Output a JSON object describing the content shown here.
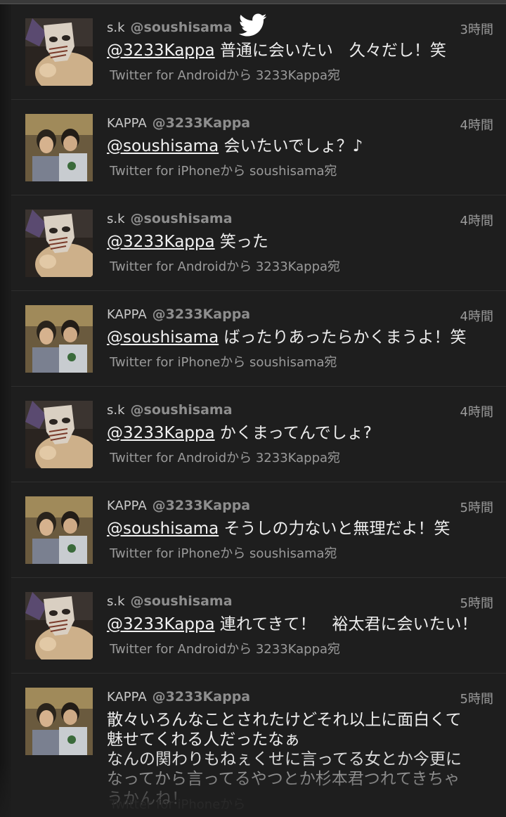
{
  "app": {
    "logo_icon": "twitter-bird-icon",
    "accent": "#ffffff"
  },
  "tweets": [
    {
      "name": "s.k",
      "handle": "@soushisama",
      "time": "3時間",
      "mention": "@3233Kappa",
      "text": "普通に会いたい　久々だし！笑",
      "via": "Twitter for Androidから 3233Kappa宛",
      "avatar": "mask-avatar"
    },
    {
      "name": "KAPPA",
      "handle": "@3233Kappa",
      "time": "4時間",
      "mention": "@soushisama",
      "text": "会いたいでしょ？♪",
      "via": "Twitter for iPhoneから soushisama宛",
      "avatar": "photo-avatar"
    },
    {
      "name": "s.k",
      "handle": "@soushisama",
      "time": "4時間",
      "mention": "@3233Kappa",
      "text": "笑った",
      "via": "Twitter for Androidから 3233Kappa宛",
      "avatar": "mask-avatar"
    },
    {
      "name": "KAPPA",
      "handle": "@3233Kappa",
      "time": "4時間",
      "mention": "@soushisama",
      "text": "ばったりあったらかくまうよ！笑",
      "via": "Twitter for iPhoneから soushisama宛",
      "avatar": "photo-avatar"
    },
    {
      "name": "s.k",
      "handle": "@soushisama",
      "time": "4時間",
      "mention": "@3233Kappa",
      "text": "かくまってんでしょ?",
      "via": "Twitter for Androidから 3233Kappa宛",
      "avatar": "mask-avatar"
    },
    {
      "name": "KAPPA",
      "handle": "@3233Kappa",
      "time": "5時間",
      "mention": "@soushisama",
      "text": "そうしの力ないと無理だよ！笑",
      "via": "Twitter for iPhoneから soushisama宛",
      "avatar": "photo-avatar"
    },
    {
      "name": "s.k",
      "handle": "@soushisama",
      "time": "5時間",
      "mention": "@3233Kappa",
      "text": "連れてきて！　裕太君に会いたい！",
      "via": "Twitter for Androidから 3233Kappa宛",
      "avatar": "mask-avatar"
    },
    {
      "name": "KAPPA",
      "handle": "@3233Kappa",
      "time": "5時間",
      "mention": "",
      "text_lines": [
        "散々いろんなことされたけどそれ以上に面白くて",
        "魅せてくれる人だったなぁ",
        "なんの関わりもねぇくせに言ってる女とか今更に",
        "なってから言ってるやつとか杉本君つれてきちゃ",
        "うかんね！"
      ],
      "via": "Twitter for iPhoneから",
      "avatar": "photo-avatar"
    }
  ]
}
